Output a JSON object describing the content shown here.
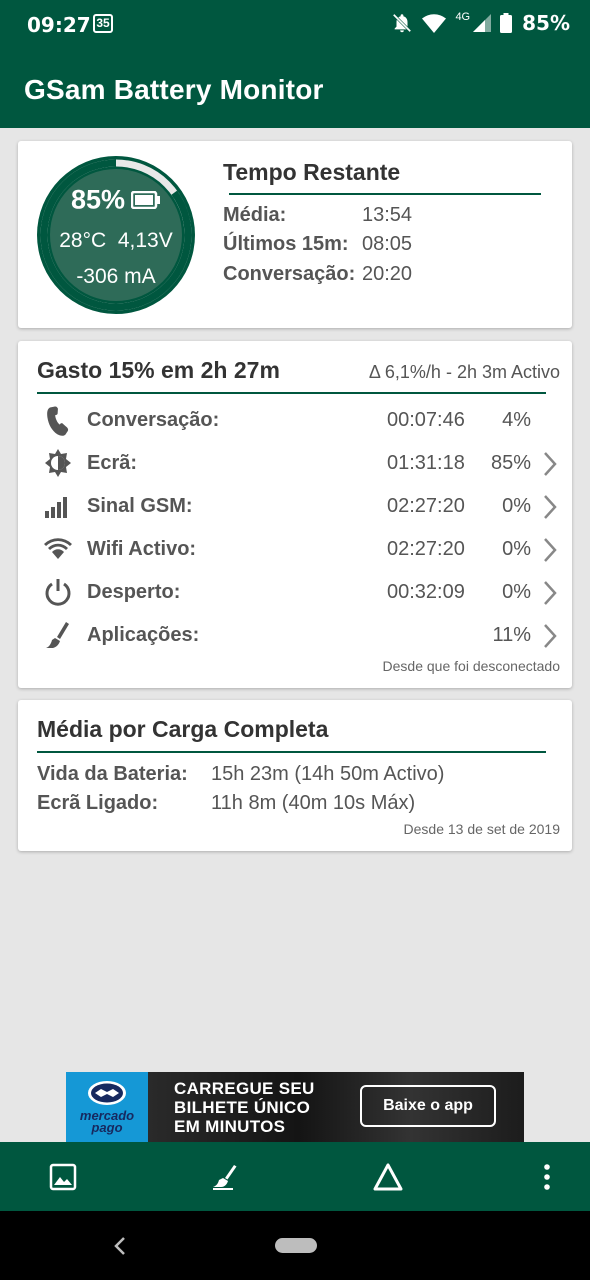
{
  "status_bar": {
    "time": "09:27",
    "notification_badge": "35",
    "network": "4G",
    "battery_percent": "85%",
    "icons": [
      "mute-icon",
      "wifi-icon",
      "signal-icon",
      "battery-icon"
    ]
  },
  "app_bar": {
    "title": "GSam Battery Monitor"
  },
  "gauge": {
    "percent": "85%",
    "level": 0.85,
    "temperature": "28°C",
    "voltage": "4,13V",
    "current": "-306 mA"
  },
  "time_remaining": {
    "title": "Tempo Restante",
    "rows": [
      {
        "label": "Média:",
        "value": "13:54"
      },
      {
        "label": "Últimos 15m:",
        "value": "08:05"
      },
      {
        "label": "Conversação:",
        "value": "20:20"
      }
    ]
  },
  "usage": {
    "title": "Gasto 15% em 2h 27m",
    "rate": "Δ 6,1%/h - 2h 3m Activo",
    "rows": [
      {
        "icon": "phone-icon",
        "label": "Conversação:",
        "time": "00:07:46",
        "percent": "4%"
      },
      {
        "icon": "brightness-icon",
        "label": "Ecrã:",
        "time": "01:31:18",
        "percent": "85%"
      },
      {
        "icon": "signal-bars-icon",
        "label": "Sinal GSM:",
        "time": "02:27:20",
        "percent": "0%"
      },
      {
        "icon": "wifi-icon",
        "label": "Wifi Activo:",
        "time": "02:27:20",
        "percent": "0%"
      },
      {
        "icon": "power-icon",
        "label": "Desperto:",
        "time": "00:32:09",
        "percent": "0%"
      },
      {
        "icon": "broom-icon",
        "label": "Aplicações:",
        "time": "",
        "percent": "11%"
      }
    ],
    "footer": "Desde que foi desconectado"
  },
  "full_charge": {
    "title": "Média por Carga Completa",
    "rows": [
      {
        "label": "Vida da Bateria:",
        "value": "15h 23m (14h 50m Activo)"
      },
      {
        "label": "Ecrã Ligado:",
        "value": "11h 8m (40m 10s Máx)"
      }
    ],
    "footer": "Desde 13 de set de 2019"
  },
  "ad": {
    "brand_line1": "mercado",
    "brand_line2": "pago",
    "headline_1": "CARREGUE SEU",
    "headline_2": "BILHETE ÚNICO",
    "headline_3": "EM MINUTOS",
    "button": "Baixe o app"
  },
  "toolbar": {
    "items": [
      "image-icon",
      "broom-icon",
      "triangle-icon",
      "more-vert-icon"
    ]
  },
  "colors": {
    "primary": "#00573f",
    "gauge_fill": "#2e6b58",
    "background": "#e6e6e6"
  }
}
